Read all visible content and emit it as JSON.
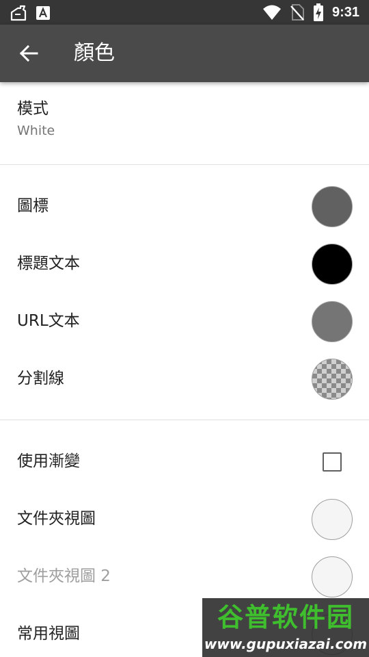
{
  "status_bar": {
    "time": "9:31",
    "icons": [
      "app-notification-icon",
      "font-a-icon",
      "wifi-icon",
      "no-sim-icon",
      "battery-charging-icon"
    ]
  },
  "app_bar": {
    "title": "顏色",
    "back_icon": "arrow-left-icon"
  },
  "mode": {
    "label": "模式",
    "value": "White"
  },
  "colors": {
    "icon": {
      "label": "圖標",
      "color": "#616161"
    },
    "title_text": {
      "label": "標題文本",
      "color": "#000000"
    },
    "url_text": {
      "label": "URL文本",
      "color": "#757575"
    },
    "divider": {
      "label": "分割線",
      "color": "checkerboard-transparent"
    }
  },
  "gradient": {
    "label": "使用漸變",
    "checked": false
  },
  "views": {
    "folder_view": {
      "label": "文件夾視圖",
      "color": "#f5f5f5"
    },
    "folder_view_2": {
      "label": "文件夾視圖 2",
      "color": "#f5f5f5",
      "disabled": true
    },
    "common_view": {
      "label": "常用視圖",
      "color": "#f5f5f5"
    }
  },
  "watermark": {
    "main": "谷普软件园",
    "url": "www.gupuxiazai.com",
    "color": "#3fbf2e"
  }
}
